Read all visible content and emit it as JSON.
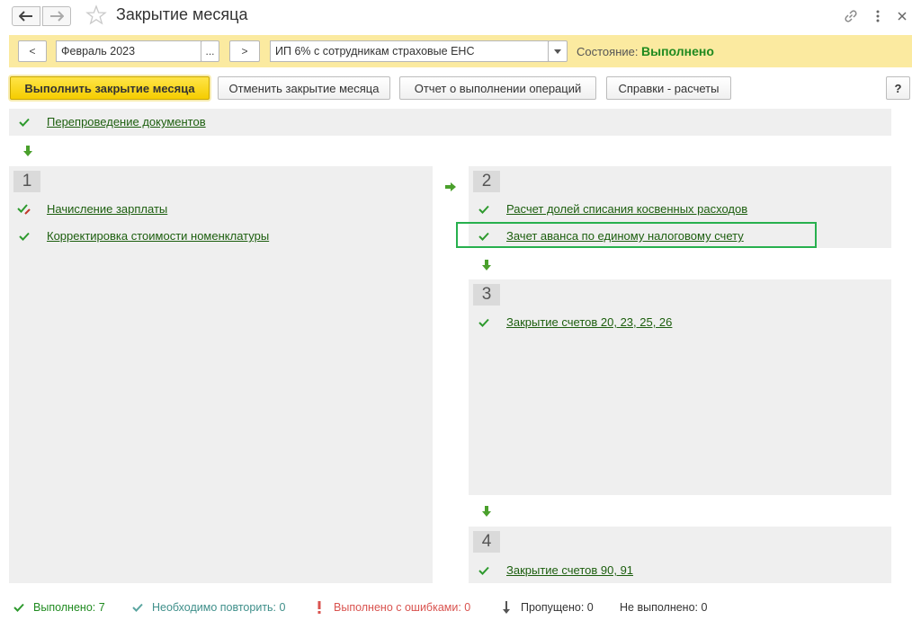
{
  "window": {
    "title": "Закрытие месяца"
  },
  "period": {
    "prev_label": "<",
    "value": "Февраль 2023",
    "select_label": "...",
    "next_label": ">"
  },
  "organization": {
    "value": "ИП 6% с сотрудникам страховые ЕНС"
  },
  "state": {
    "label": "Состояние:",
    "value": "Выполнено"
  },
  "toolbar": {
    "run_label": "Выполнить закрытие месяца",
    "cancel_label": "Отменить закрытие месяца",
    "report_label": "Отчет о выполнении операций",
    "help_calc_label": "Справки - расчеты",
    "help_label": "?"
  },
  "steps": {
    "pre": {
      "item": "Перепроведение документов"
    },
    "s1": {
      "number": "1",
      "items": [
        "Начисление зарплаты",
        "Корректировка стоимости номенклатуры"
      ]
    },
    "s2": {
      "number": "2",
      "items": [
        "Расчет долей списания косвенных расходов",
        "Зачет аванса по единому налоговому счету"
      ]
    },
    "s3": {
      "number": "3",
      "items": [
        "Закрытие счетов 20, 23, 25, 26"
      ]
    },
    "s4": {
      "number": "4",
      "items": [
        "Закрытие счетов 90, 91"
      ]
    }
  },
  "status": {
    "done": "Выполнено: 7",
    "repeat": "Необходимо повторить: 0",
    "errors": "Выполнено с ошибками: 0",
    "skipped": "Пропущено: 0",
    "not_done": "Не выполнено: 0"
  },
  "colors": {
    "accent_yellow": "#fbeaa0",
    "done_green": "#1f8a1f",
    "link_green": "#1c5e0e",
    "repeat_teal": "#3f8f8a",
    "error_red": "#d9534f",
    "highlight_green": "#27b04e"
  }
}
